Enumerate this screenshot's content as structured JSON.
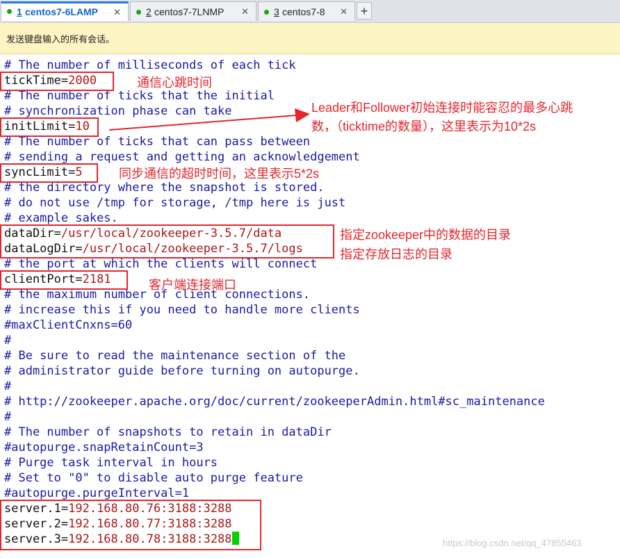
{
  "tabs": [
    {
      "num": "1",
      "name": "centos7-6LAMP",
      "close": "✕"
    },
    {
      "num": "2",
      "name": "centos7-7LNMP",
      "close": "✕"
    },
    {
      "num": "3",
      "name": "centos7-8",
      "close": "✕"
    }
  ],
  "add_tab_label": "+",
  "notice": "发送键盘输入的所有会话。",
  "lines": {
    "l1": "# The number of milliseconds of each tick",
    "l2_key": "tickTime=",
    "l2_val": "2000",
    "l3": "# The number of ticks that the initial",
    "l4": "# synchronization phase can take",
    "l5_key": "initLimit=",
    "l5_val": "10",
    "l6": "# The number of ticks that can pass between",
    "l7": "# sending a request and getting an acknowledgement",
    "l8_key": "syncLimit=",
    "l8_val": "5",
    "l9": "# the directory where the snapshot is stored.",
    "l10": "# do not use /tmp for storage, /tmp here is just",
    "l11": "# example sakes.",
    "l12_key": "dataDir=",
    "l12_val": "/usr/local/zookeeper-3.5.7/data",
    "l13_key": "dataLogDir=",
    "l13_val": "/usr/local/zookeeper-3.5.7/logs",
    "l14": "# the port at which the clients will connect",
    "l15_key": "clientPort=",
    "l15_val": "2181",
    "l16": "# the maximum number of client connections.",
    "l17": "# increase this if you need to handle more clients",
    "l18": "#maxClientCnxns=60",
    "l19": "#",
    "l20": "# Be sure to read the maintenance section of the",
    "l21": "# administrator guide before turning on autopurge.",
    "l22": "#",
    "l23": "# http://zookeeper.apache.org/doc/current/zookeeperAdmin.html#sc_maintenance",
    "l24": "#",
    "l25": "# The number of snapshots to retain in dataDir",
    "l26": "#autopurge.snapRetainCount=3",
    "l27": "# Purge task interval in hours",
    "l28": "# Set to \"0\" to disable auto purge feature",
    "l29": "#autopurge.purgeInterval=1",
    "l30_key": "server.1=",
    "l30_val": "192.168.80.76:3188:3288",
    "l31_key": "server.2=",
    "l31_val": "192.168.80.77:3188:3288",
    "l32_key": "server.3=",
    "l32_val": "192.168.80.78:3188:3288"
  },
  "annotations": {
    "ticktime": "通信心跳时间",
    "initlimit_1": "Leader和Follower初始连接时能容忍的最多心跳",
    "initlimit_2": "数，（ticktime的数量），这里表示为10*2s",
    "synclimit": "同步通信的超时时间，这里表示5*2s",
    "datadir": "指定zookeeper中的数据的目录",
    "datalogdir": "指定存放日志的目录",
    "clientport": "客户端连接端口"
  },
  "watermark": "https://blog.csdn.net/qq_47855463",
  "colors": {
    "annotation": "#e3262c",
    "comment": "#1a1aa6",
    "value": "#a81818",
    "cursor": "#00d400"
  }
}
